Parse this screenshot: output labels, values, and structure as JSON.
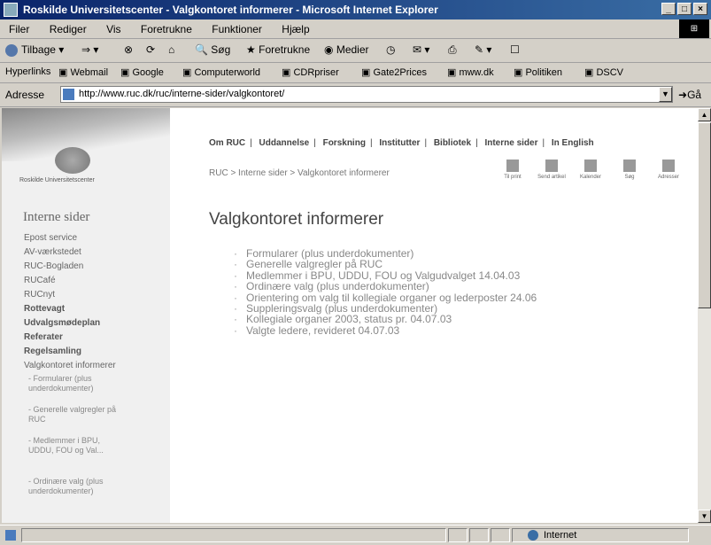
{
  "window": {
    "title": "Roskilde Universitetscenter - Valgkontoret informerer - Microsoft Internet Explorer"
  },
  "menu": [
    "Filer",
    "Rediger",
    "Vis",
    "Foretrukne",
    "Funktioner",
    "Hjælp"
  ],
  "toolbar": {
    "back": "Tilbage",
    "search": "Søg",
    "favorites": "Foretrukne",
    "media": "Medier"
  },
  "links": {
    "label": "Hyperlinks",
    "items": [
      "Webmail",
      "Google",
      "Computerworld",
      "CDRpriser",
      "Gate2Prices",
      "mww.dk",
      "Politiken",
      "DSCV"
    ]
  },
  "address": {
    "label": "Adresse",
    "url": "http://www.ruc.dk/ruc/interne-sider/valgkontoret/",
    "go": "Gå"
  },
  "logo_text": "Roskilde Universitetscenter",
  "topnav": [
    "Om RUC",
    "Uddannelse",
    "Forskning",
    "Institutter",
    "Bibliotek",
    "Interne sider",
    "In English"
  ],
  "breadcrumb": "RUC > Interne sider > Valgkontoret informerer",
  "tools": [
    "Til print",
    "Send artikel",
    "Kalender",
    "Søg",
    "Adresser"
  ],
  "sidebar": {
    "heading": "Interne sider",
    "items": [
      {
        "label": "Epost service",
        "bold": false
      },
      {
        "label": "AV-værkstedet",
        "bold": false
      },
      {
        "label": "RUC-Bogladen",
        "bold": false
      },
      {
        "label": "RUCafé",
        "bold": false
      },
      {
        "label": "RUCnyt",
        "bold": false
      },
      {
        "label": "Rottevagt",
        "bold": true
      },
      {
        "label": "Udvalgsmødeplan",
        "bold": true
      },
      {
        "label": "Referater",
        "bold": true
      },
      {
        "label": "Regelsamling",
        "bold": true
      },
      {
        "label": "Valgkontoret informerer",
        "bold": false
      }
    ],
    "subitems": [
      "- Formularer (plus underdokumenter)",
      "- Generelle valgregler på RUC",
      "- Medlemmer i BPU, UDDU, FOU og Val...",
      "- Ordinære valg (plus underdokumenter)"
    ]
  },
  "main": {
    "title": "Valgkontoret informerer",
    "items": [
      "Formularer (plus underdokumenter)",
      "Generelle valgregler på RUC",
      "Medlemmer i BPU, UDDU, FOU og Valgudvalget 14.04.03",
      "Ordinære valg (plus underdokumenter)",
      "Orientering om valg til kollegiale organer og lederposter 24.06",
      "Suppleringsvalg (plus underdokumenter)",
      "Kollegiale organer 2003, status pr. 04.07.03",
      "Valgte ledere, revideret 04.07.03"
    ]
  },
  "status": {
    "zone": "Internet"
  }
}
